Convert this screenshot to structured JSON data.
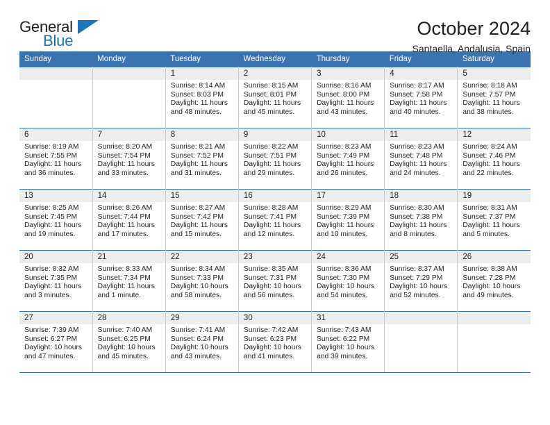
{
  "logo": {
    "primary_text": "General",
    "secondary_text": "Blue",
    "primary_color": "#231f20",
    "accent_color": "#1b75bb",
    "shape": "triangle"
  },
  "header": {
    "title": "October 2024",
    "subtitle": "Santaella, Andalusia, Spain"
  },
  "theme": {
    "header_blue": "#3b72b0",
    "daynum_band": "#ededed",
    "grid_line": "#c9c9c9",
    "text": "#231f20"
  },
  "calendar": {
    "weekday_headers": [
      "Sunday",
      "Monday",
      "Tuesday",
      "Wednesday",
      "Thursday",
      "Friday",
      "Saturday"
    ],
    "labels": {
      "sunrise_prefix": "Sunrise:",
      "sunset_prefix": "Sunset:",
      "daylight_prefix": "Daylight:"
    },
    "weeks": [
      [
        {
          "day": "",
          "empty": true
        },
        {
          "day": "",
          "empty": true
        },
        {
          "day": "1",
          "sunrise": "Sunrise: 8:14 AM",
          "sunset": "Sunset: 8:03 PM",
          "daylight_line1": "Daylight: 11 hours",
          "daylight_line2": "and 48 minutes."
        },
        {
          "day": "2",
          "sunrise": "Sunrise: 8:15 AM",
          "sunset": "Sunset: 8:01 PM",
          "daylight_line1": "Daylight: 11 hours",
          "daylight_line2": "and 45 minutes."
        },
        {
          "day": "3",
          "sunrise": "Sunrise: 8:16 AM",
          "sunset": "Sunset: 8:00 PM",
          "daylight_line1": "Daylight: 11 hours",
          "daylight_line2": "and 43 minutes."
        },
        {
          "day": "4",
          "sunrise": "Sunrise: 8:17 AM",
          "sunset": "Sunset: 7:58 PM",
          "daylight_line1": "Daylight: 11 hours",
          "daylight_line2": "and 40 minutes."
        },
        {
          "day": "5",
          "sunrise": "Sunrise: 8:18 AM",
          "sunset": "Sunset: 7:57 PM",
          "daylight_line1": "Daylight: 11 hours",
          "daylight_line2": "and 38 minutes."
        }
      ],
      [
        {
          "day": "6",
          "sunrise": "Sunrise: 8:19 AM",
          "sunset": "Sunset: 7:55 PM",
          "daylight_line1": "Daylight: 11 hours",
          "daylight_line2": "and 36 minutes."
        },
        {
          "day": "7",
          "sunrise": "Sunrise: 8:20 AM",
          "sunset": "Sunset: 7:54 PM",
          "daylight_line1": "Daylight: 11 hours",
          "daylight_line2": "and 33 minutes."
        },
        {
          "day": "8",
          "sunrise": "Sunrise: 8:21 AM",
          "sunset": "Sunset: 7:52 PM",
          "daylight_line1": "Daylight: 11 hours",
          "daylight_line2": "and 31 minutes."
        },
        {
          "day": "9",
          "sunrise": "Sunrise: 8:22 AM",
          "sunset": "Sunset: 7:51 PM",
          "daylight_line1": "Daylight: 11 hours",
          "daylight_line2": "and 29 minutes."
        },
        {
          "day": "10",
          "sunrise": "Sunrise: 8:23 AM",
          "sunset": "Sunset: 7:49 PM",
          "daylight_line1": "Daylight: 11 hours",
          "daylight_line2": "and 26 minutes."
        },
        {
          "day": "11",
          "sunrise": "Sunrise: 8:23 AM",
          "sunset": "Sunset: 7:48 PM",
          "daylight_line1": "Daylight: 11 hours",
          "daylight_line2": "and 24 minutes."
        },
        {
          "day": "12",
          "sunrise": "Sunrise: 8:24 AM",
          "sunset": "Sunset: 7:46 PM",
          "daylight_line1": "Daylight: 11 hours",
          "daylight_line2": "and 22 minutes."
        }
      ],
      [
        {
          "day": "13",
          "sunrise": "Sunrise: 8:25 AM",
          "sunset": "Sunset: 7:45 PM",
          "daylight_line1": "Daylight: 11 hours",
          "daylight_line2": "and 19 minutes."
        },
        {
          "day": "14",
          "sunrise": "Sunrise: 8:26 AM",
          "sunset": "Sunset: 7:44 PM",
          "daylight_line1": "Daylight: 11 hours",
          "daylight_line2": "and 17 minutes."
        },
        {
          "day": "15",
          "sunrise": "Sunrise: 8:27 AM",
          "sunset": "Sunset: 7:42 PM",
          "daylight_line1": "Daylight: 11 hours",
          "daylight_line2": "and 15 minutes."
        },
        {
          "day": "16",
          "sunrise": "Sunrise: 8:28 AM",
          "sunset": "Sunset: 7:41 PM",
          "daylight_line1": "Daylight: 11 hours",
          "daylight_line2": "and 12 minutes."
        },
        {
          "day": "17",
          "sunrise": "Sunrise: 8:29 AM",
          "sunset": "Sunset: 7:39 PM",
          "daylight_line1": "Daylight: 11 hours",
          "daylight_line2": "and 10 minutes."
        },
        {
          "day": "18",
          "sunrise": "Sunrise: 8:30 AM",
          "sunset": "Sunset: 7:38 PM",
          "daylight_line1": "Daylight: 11 hours",
          "daylight_line2": "and 8 minutes."
        },
        {
          "day": "19",
          "sunrise": "Sunrise: 8:31 AM",
          "sunset": "Sunset: 7:37 PM",
          "daylight_line1": "Daylight: 11 hours",
          "daylight_line2": "and 5 minutes."
        }
      ],
      [
        {
          "day": "20",
          "sunrise": "Sunrise: 8:32 AM",
          "sunset": "Sunset: 7:35 PM",
          "daylight_line1": "Daylight: 11 hours",
          "daylight_line2": "and 3 minutes."
        },
        {
          "day": "21",
          "sunrise": "Sunrise: 8:33 AM",
          "sunset": "Sunset: 7:34 PM",
          "daylight_line1": "Daylight: 11 hours",
          "daylight_line2": "and 1 minute."
        },
        {
          "day": "22",
          "sunrise": "Sunrise: 8:34 AM",
          "sunset": "Sunset: 7:33 PM",
          "daylight_line1": "Daylight: 10 hours",
          "daylight_line2": "and 58 minutes."
        },
        {
          "day": "23",
          "sunrise": "Sunrise: 8:35 AM",
          "sunset": "Sunset: 7:31 PM",
          "daylight_line1": "Daylight: 10 hours",
          "daylight_line2": "and 56 minutes."
        },
        {
          "day": "24",
          "sunrise": "Sunrise: 8:36 AM",
          "sunset": "Sunset: 7:30 PM",
          "daylight_line1": "Daylight: 10 hours",
          "daylight_line2": "and 54 minutes."
        },
        {
          "day": "25",
          "sunrise": "Sunrise: 8:37 AM",
          "sunset": "Sunset: 7:29 PM",
          "daylight_line1": "Daylight: 10 hours",
          "daylight_line2": "and 52 minutes."
        },
        {
          "day": "26",
          "sunrise": "Sunrise: 8:38 AM",
          "sunset": "Sunset: 7:28 PM",
          "daylight_line1": "Daylight: 10 hours",
          "daylight_line2": "and 49 minutes."
        }
      ],
      [
        {
          "day": "27",
          "sunrise": "Sunrise: 7:39 AM",
          "sunset": "Sunset: 6:27 PM",
          "daylight_line1": "Daylight: 10 hours",
          "daylight_line2": "and 47 minutes."
        },
        {
          "day": "28",
          "sunrise": "Sunrise: 7:40 AM",
          "sunset": "Sunset: 6:25 PM",
          "daylight_line1": "Daylight: 10 hours",
          "daylight_line2": "and 45 minutes."
        },
        {
          "day": "29",
          "sunrise": "Sunrise: 7:41 AM",
          "sunset": "Sunset: 6:24 PM",
          "daylight_line1": "Daylight: 10 hours",
          "daylight_line2": "and 43 minutes."
        },
        {
          "day": "30",
          "sunrise": "Sunrise: 7:42 AM",
          "sunset": "Sunset: 6:23 PM",
          "daylight_line1": "Daylight: 10 hours",
          "daylight_line2": "and 41 minutes."
        },
        {
          "day": "31",
          "sunrise": "Sunrise: 7:43 AM",
          "sunset": "Sunset: 6:22 PM",
          "daylight_line1": "Daylight: 10 hours",
          "daylight_line2": "and 39 minutes."
        },
        {
          "day": "",
          "empty": true
        },
        {
          "day": "",
          "empty": true
        }
      ]
    ]
  }
}
